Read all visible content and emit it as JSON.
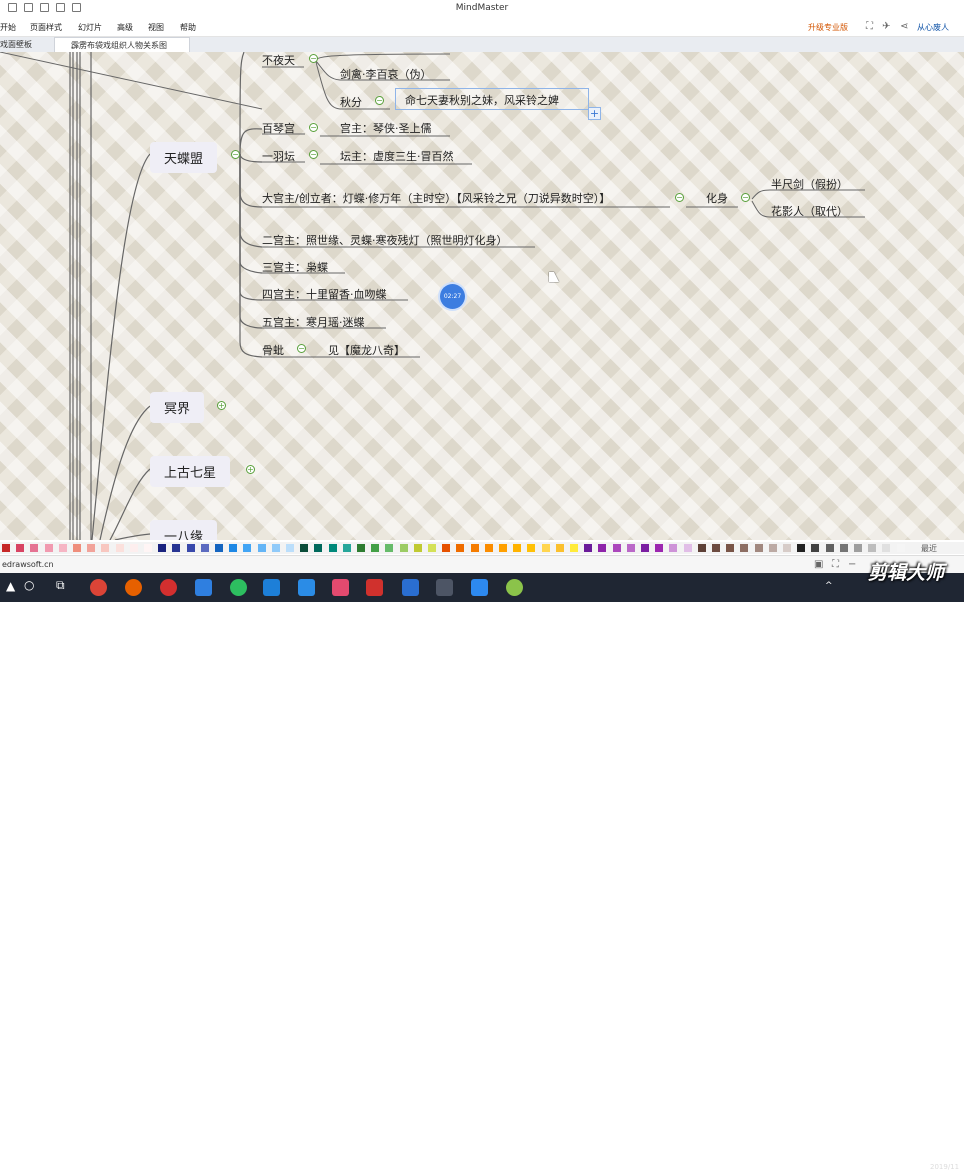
{
  "window": {
    "title": "MindMaster"
  },
  "menu": {
    "items": [
      "开始",
      "页面样式",
      "幻灯片",
      "高级",
      "视图",
      "帮助"
    ]
  },
  "account": {
    "upgrade": "升级专业版",
    "user": "从心废人"
  },
  "tabs": {
    "tab1": "戏面壁板",
    "tab2": "霹雳布袋戏组织人物关系图"
  },
  "mindmap": {
    "top": {
      "buyetian": "不夜天",
      "jianqin": "剑禽·李百哀（伪）",
      "qiufen": "秋分",
      "qiufen_note": "命七天妻秋别之妹，风采铃之婢"
    },
    "tiandie": {
      "label": "天蝶盟",
      "baiqin": "百琴宫",
      "baiqin_lord": "宫主：琴侠·圣上儒",
      "yiyu": "一羽坛",
      "yiyu_lord": "坛主：虚度三生·冒百然",
      "leader": "大宫主/创立者：灯蝶·修万年（主时空）【风采铃之兄（刀说异数时空）】",
      "huashen": "化身",
      "banchi": "半尺剑（假扮）",
      "huaying": "花影人（取代）",
      "second": "二宫主：照世缘、灵蝶·寒夜残灯（照世明灯化身）",
      "third": "三宫主：枭蝶",
      "fourth": "四宫主：十里留香·血吻蝶",
      "fifth": "五宫主：寒月瑶·迷蝶",
      "gupi": "骨蚍",
      "gupi_ref": "见【魔龙八奇】"
    },
    "mingjie": "冥界",
    "shanggu": "上古七星",
    "partial": "一八缘"
  },
  "overlay": {
    "timer": "02:27"
  },
  "palette_label": "最近",
  "status": {
    "site": "edrawsoft.cn"
  },
  "watermark": "剪辑大师",
  "clock": {
    "date": "2019/11"
  }
}
